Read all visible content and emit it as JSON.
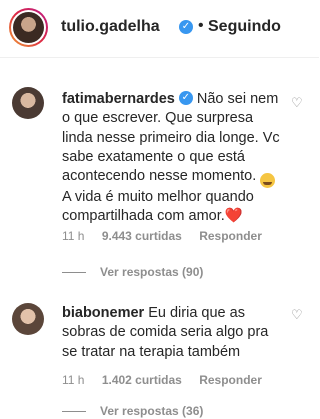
{
  "header": {
    "username": "tulio.gadelha",
    "verified_badge": "✓",
    "separator": "•",
    "follow_status": "Seguindo"
  },
  "comments": [
    {
      "username": "fatimabernardes",
      "verified": true,
      "text": "Não sei nem o que escrever. Que surpresa linda nesse primeiro dia longe. Vc sabe exatamente o que está acontecendo nesse momento.",
      "emoji_1": "😭",
      "text_2": "A vida é muito melhor quando compartilhada com amor.",
      "emoji_2": "❤️",
      "time": "11 h",
      "likes": "9.443 curtidas",
      "reply": "Responder",
      "view_replies": "Ver respostas (90)"
    },
    {
      "username": "biabonemer",
      "verified": false,
      "text": "Eu diria que as sobras de comida seria algo pra se tratar na terapia também",
      "time": "11 h",
      "likes": "1.402 curtidas",
      "reply": "Responder",
      "view_replies": "Ver respostas (36)"
    }
  ],
  "icons": {
    "like": "heart-outline-icon",
    "verified": "verified-badge-icon"
  },
  "colors": {
    "verified_blue": "#3897f0",
    "secondary_text": "#8e8e8e",
    "primary_text": "#262626"
  }
}
